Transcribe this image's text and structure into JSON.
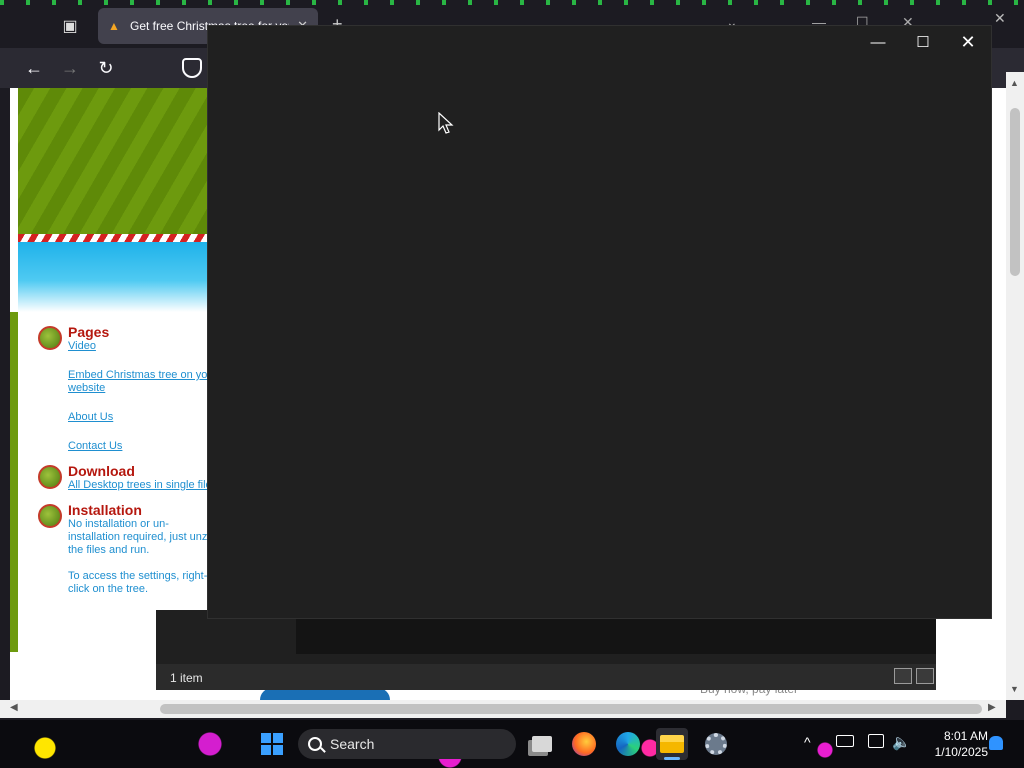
{
  "browser": {
    "tab_title": "Get free Christmas tree for your",
    "tab_close": "✕",
    "new_tab": "+"
  },
  "page": {
    "sections": [
      {
        "heading": "Pages",
        "links": [
          "Video",
          "Embed Christmas tree on your website",
          "About Us",
          "Contact Us"
        ]
      },
      {
        "heading": "Download",
        "links": [
          "All Desktop trees in single file"
        ]
      },
      {
        "heading": "Installation",
        "paragraphs": [
          "No installation or un-installation required, just unzip the files and run.",
          "To access the settings, right-click on the tree."
        ]
      }
    ],
    "partial_text": "Buy now, pay later"
  },
  "explorer": {
    "status_text": "1 item"
  },
  "taskbar": {
    "search_label": "Search",
    "time": "8:01 AM",
    "date": "1/10/2025"
  }
}
